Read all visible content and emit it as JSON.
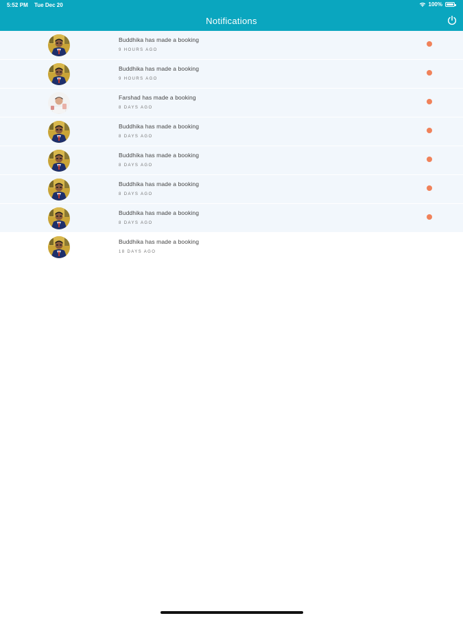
{
  "status_bar": {
    "time": "5:52 PM",
    "date": "Tue Dec 20",
    "battery": "100%"
  },
  "header": {
    "title": "Notifications",
    "power_icon": "power-icon"
  },
  "colors": {
    "header_bg": "#0aa6bf",
    "unread_dot": "#f0825a",
    "unread_row_bg": "#f2f7fc"
  },
  "notifications": [
    {
      "user": "Buddhika",
      "message": "Buddhika has made a booking",
      "time": "9 HOURS AGO",
      "unread": true,
      "avatar": "avatar-buddhika"
    },
    {
      "user": "Buddhika",
      "message": "Buddhika has made a booking",
      "time": "9 HOURS AGO",
      "unread": true,
      "avatar": "avatar-buddhika"
    },
    {
      "user": "Farshad",
      "message": "Farshad has made a booking",
      "time": "8 DAYS AGO",
      "unread": true,
      "avatar": "avatar-farshad"
    },
    {
      "user": "Buddhika",
      "message": "Buddhika has made a booking",
      "time": "8 DAYS AGO",
      "unread": true,
      "avatar": "avatar-buddhika"
    },
    {
      "user": "Buddhika",
      "message": "Buddhika has made a booking",
      "time": "8 DAYS AGO",
      "unread": true,
      "avatar": "avatar-buddhika"
    },
    {
      "user": "Buddhika",
      "message": "Buddhika has made a booking",
      "time": "8 DAYS AGO",
      "unread": true,
      "avatar": "avatar-buddhika"
    },
    {
      "user": "Buddhika",
      "message": "Buddhika has made a booking",
      "time": "8 DAYS AGO",
      "unread": true,
      "avatar": "avatar-buddhika"
    },
    {
      "user": "Buddhika",
      "message": "Buddhika has made a booking",
      "time": "18 DAYS AGO",
      "unread": false,
      "avatar": "avatar-buddhika"
    }
  ]
}
